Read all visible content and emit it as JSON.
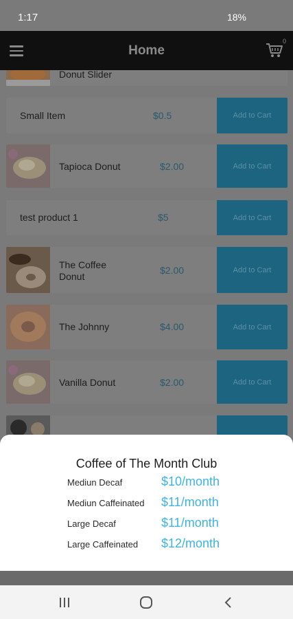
{
  "status_bar": {
    "time": "1:17",
    "icons": "▣ ⏰ ⋮⋮ ◢",
    "battery": "18%"
  },
  "app_bar": {
    "title": "Home",
    "cart_count": "0"
  },
  "products": [
    {
      "name": "Donut Slider",
      "price": "",
      "button": ""
    },
    {
      "name": "Small Item",
      "price": "$0.5",
      "button": "Add to Cart"
    },
    {
      "name": "Tapioca Donut",
      "price": "$2.00",
      "button": "Add to Cart"
    },
    {
      "name": "test product 1",
      "price": "$5",
      "button": "Add to Cart"
    },
    {
      "name": "The Coffee Donut",
      "price": "$2.00",
      "button": "Add to Cart"
    },
    {
      "name": "The Johnny",
      "price": "$4.00",
      "button": "Add to Cart"
    },
    {
      "name": "Vanilla Donut",
      "price": "$2.00",
      "button": "Add to Cart"
    }
  ],
  "modal": {
    "title": "Coffee of The Month Club",
    "plans": [
      {
        "label": "Mediun Decaf",
        "price": "$10/month"
      },
      {
        "label": "Mediun Caffeinated",
        "price": "$11/month"
      },
      {
        "label": "Large Decaf",
        "price": "$11/month"
      },
      {
        "label": "Large Caffeinated",
        "price": "$12/month"
      }
    ]
  },
  "colors": {
    "accent": "#3cb4e4",
    "app_bar": "#101010",
    "button_dimmed": "#1c6480"
  }
}
